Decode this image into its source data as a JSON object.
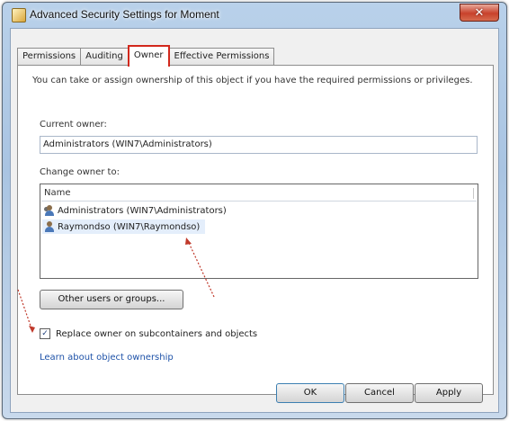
{
  "window": {
    "title": "Advanced Security Settings for Moment",
    "close_glyph": "✕"
  },
  "tabs": [
    {
      "label": "Permissions",
      "active": false
    },
    {
      "label": "Auditing",
      "active": false
    },
    {
      "label": "Owner",
      "active": true
    },
    {
      "label": "Effective Permissions",
      "active": false
    }
  ],
  "owner": {
    "intro": "You can take or assign ownership of this object if you have the required permissions or privileges.",
    "current_owner_label": "Current owner:",
    "current_owner_value": "Administrators (WIN7\\Administrators)",
    "change_owner_label": "Change owner to:",
    "list_header": "Name",
    "list_items": [
      {
        "name": "Administrators (WIN7\\Administrators)",
        "icon": "group-icon",
        "selected": false
      },
      {
        "name": "Raymondso (WIN7\\Raymondso)",
        "icon": "user-icon",
        "selected": true
      }
    ],
    "other_button": "Other users or groups...",
    "replace_checkbox": "Replace owner on subcontainers and objects",
    "replace_checked": true,
    "learn_link": "Learn about object ownership"
  },
  "buttons": {
    "ok": "OK",
    "cancel": "Cancel",
    "apply": "Apply"
  },
  "colors": {
    "annotation": "#c0392b"
  }
}
